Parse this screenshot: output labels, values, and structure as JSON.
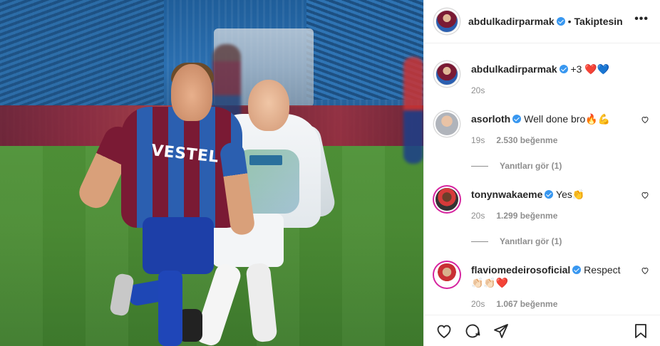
{
  "post": {
    "author": "abdulkadirparmak",
    "follow_status": "Takiptesin",
    "more_icon": "more-icon",
    "caption": {
      "username": "abdulkadirparmak",
      "text": "+3",
      "emojis": "❤️💙",
      "time": "20s"
    }
  },
  "comments": [
    {
      "username": "asorloth",
      "text": "Well done bro",
      "emojis": "🔥💪",
      "time": "19s",
      "likes": "2.530 beğenme",
      "replies": "Yanıtları gör (1)"
    },
    {
      "username": "tonynwakaeme",
      "text": "Yes",
      "emojis": "👏",
      "time": "20s",
      "likes": "1.299 beğenme",
      "replies": "Yanıtları gör (1)"
    },
    {
      "username": "flaviomedeirosoficial",
      "text": "Respect",
      "emojis": "👏🏻👏🏻❤️",
      "time": "20s",
      "likes": "1.067 beğenme"
    }
  ],
  "photo_text": {
    "sponsor": "VESTEL"
  },
  "colors": {
    "verified_blue": "#3897f0",
    "text_primary": "#262626",
    "text_secondary": "#8e8e8e",
    "divider": "#efefef"
  }
}
